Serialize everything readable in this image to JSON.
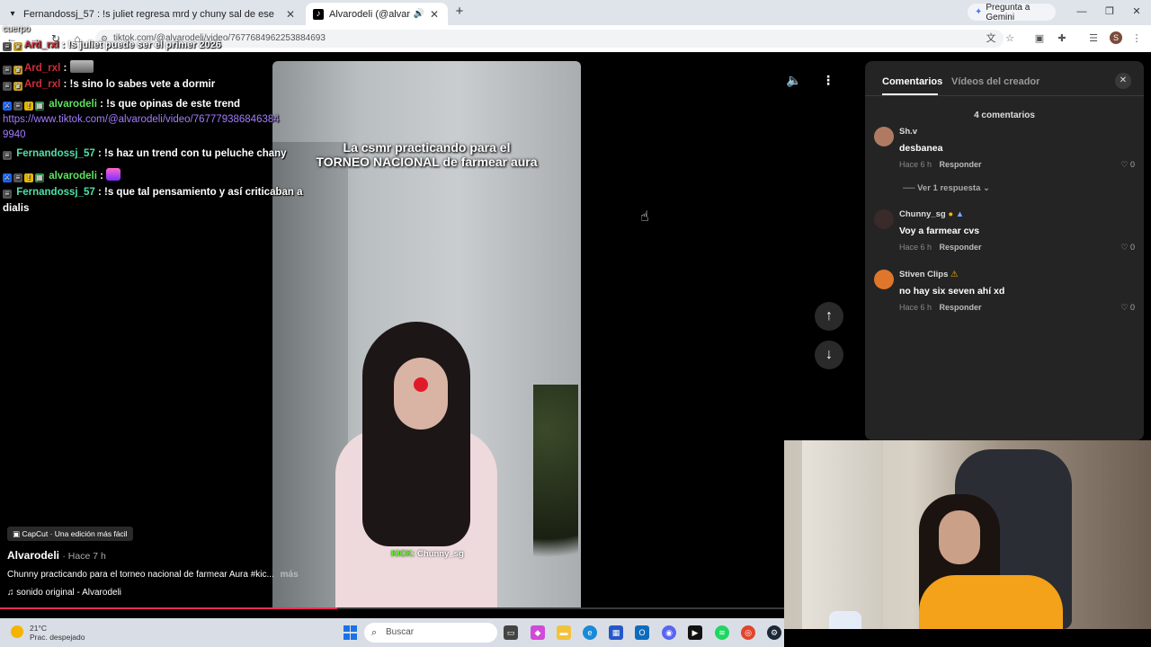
{
  "browser": {
    "tab1_title": "Fernandossj_57 : !s juliet regresa mrd y chuny sal de ese",
    "tab2_title": "Alvarodeli (@alvarodeli) | T",
    "gemini_label": "Pregunta a Gemini",
    "url": "tiktok.com/@alvarodeli/video/7677684962253884693"
  },
  "chat": {
    "overflow_text": "cuerpo",
    "messages": [
      {
        "user": "Ard_rxl",
        "text": ": !s juliet puede ser el primer 2026"
      },
      {
        "user": "Ard_rxl",
        "text": ":"
      },
      {
        "user": "Ard_rxl",
        "text": ": !s sino lo sabes vete a dormir"
      },
      {
        "user": "alvarodeli",
        "text": ": !s que opinas de este trend"
      },
      {
        "link": "https://www.tiktok.com/@alvarodeli/video/767779386846384",
        "link_cont": "9940"
      },
      {
        "user": "Fernandossj_57",
        "text": ": !s haz un trend con tu peluche chany"
      },
      {
        "user": "alvarodeli",
        "text": ":"
      },
      {
        "user": "Fernandossj_57",
        "text": ": !s que tal pensamiento y así criticaban a",
        "text_cont": "dialis"
      }
    ]
  },
  "video": {
    "caption_line1": "La csmr practicando para el",
    "caption_line2": "TORNEO NACIONAL de farmear aura",
    "kick_label": "KICK:",
    "kick_user": "Chunny_sg",
    "progress": 0.43
  },
  "info": {
    "capcut": "CapCut · Una edición más fácil",
    "author": "Alvarodeli",
    "ago": "· Hace 7 h",
    "description": "Chunny practicando para el torneo nacional de farmear Aura #kic...",
    "more": "más",
    "sound": "sonido original - Alvarodeli"
  },
  "panel": {
    "tab_comments": "Comentarios",
    "tab_creator": "Vídeos del creador",
    "count": "4 comentarios",
    "view_replies": "Ver 1 respuesta",
    "comments": [
      {
        "name": "Sh.v",
        "text": "desbanea",
        "time": "Hace 6 h",
        "reply": "Responder",
        "likes": "0"
      },
      {
        "name": "Chunny_sg",
        "text": "Voy a farmear cvs",
        "time": "Hace 6 h",
        "reply": "Responder",
        "likes": "0"
      },
      {
        "name": "Stiven Clips",
        "text": "no hay six seven ahí xd",
        "time": "Hace 6 h",
        "reply": "Responder",
        "likes": "0"
      }
    ]
  },
  "taskbar": {
    "temp": "21°C",
    "weather": "Prac. despejado",
    "search": "Buscar"
  }
}
